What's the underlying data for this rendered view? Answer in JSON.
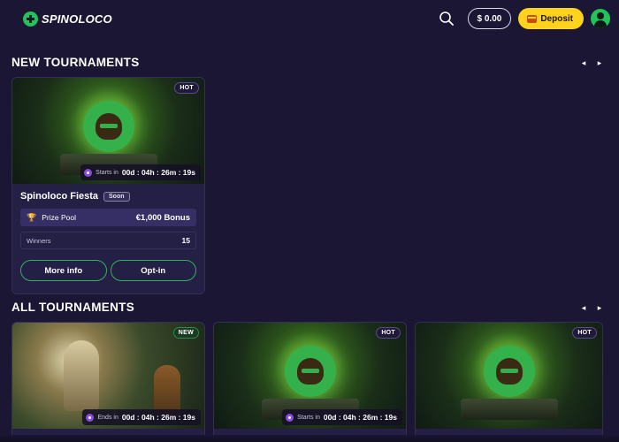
{
  "header": {
    "brand": "SPINOLOCO",
    "balance": "$ 0.00",
    "deposit_label": "Deposit"
  },
  "sections": {
    "new_title": "NEW TOURNAMENTS",
    "all_title": "ALL TOURNAMENTS",
    "prev_arrow": "◂",
    "next_arrow": "▸"
  },
  "featured_card": {
    "badge": "HOT",
    "timer_label": "Starts in",
    "timer_value": "00d : 04h : 26m : 19s",
    "title": "Spinoloco Fiesta",
    "status": "Soon",
    "prize_label": "Prize Pool",
    "prize_value": "€1,000 Bonus",
    "winners_label": "Winners",
    "winners_value": "15",
    "more_info": "More info",
    "opt_in": "Opt-in"
  },
  "all_cards": [
    {
      "badge": "NEW",
      "timer_label": "Ends in",
      "timer_value": "00d : 04h : 26m : 19s"
    },
    {
      "badge": "HOT",
      "timer_label": "Starts in",
      "timer_value": "00d : 04h : 26m : 19s"
    },
    {
      "badge": "HOT",
      "timer_label": "",
      "timer_value": ""
    }
  ],
  "colors": {
    "background": "#1a1633",
    "card": "#241f45",
    "accent_green": "#20c45a",
    "deposit_yellow": "#ffd21c",
    "prize_row": "#352f66"
  },
  "icons": [
    "logo-icon",
    "search-icon",
    "wallet-icon",
    "avatar-icon",
    "trophy-icon",
    "timer-icon"
  ]
}
